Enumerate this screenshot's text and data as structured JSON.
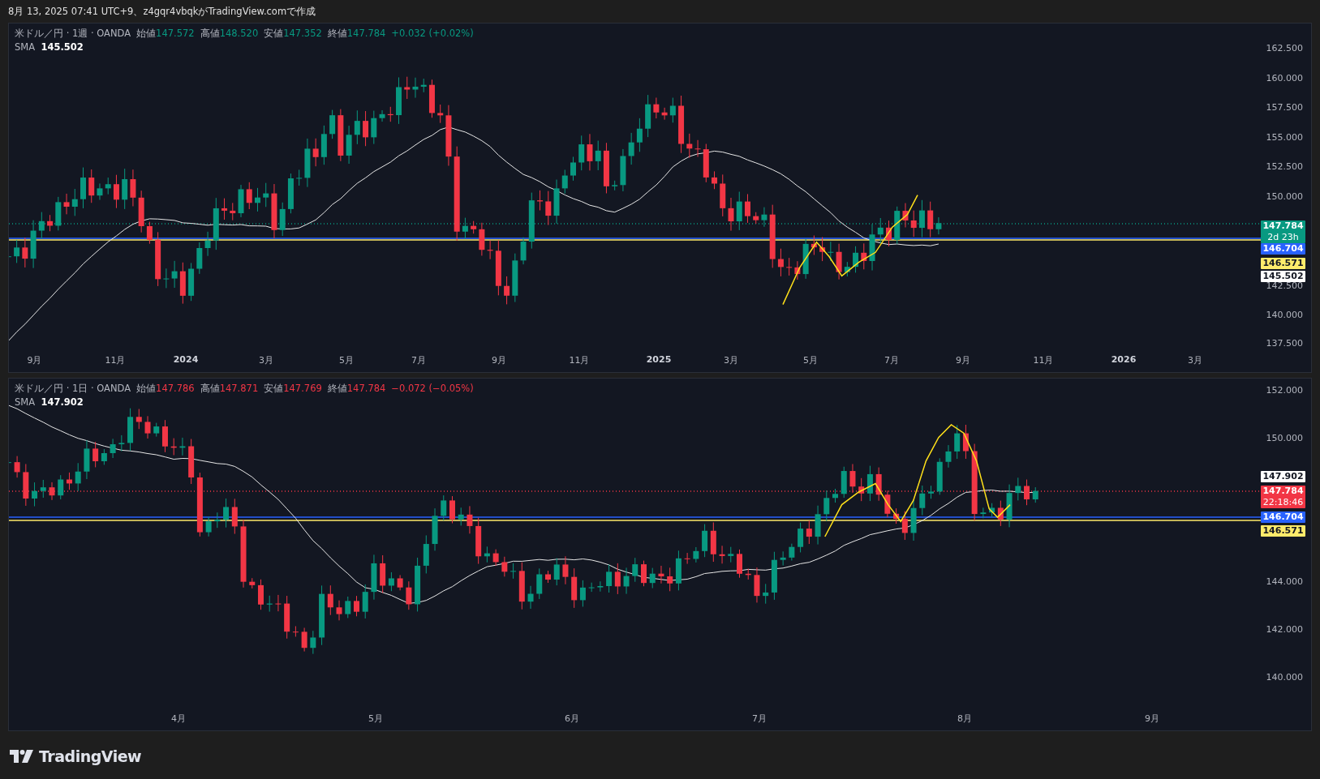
{
  "header": {
    "text": "8月 13, 2025 07:41 UTC+9、z4gqr4vbqkがTradingView.comで作成"
  },
  "panes": [
    {
      "symbol": "米ドル／円 · 1週 · OANDA",
      "rising": true,
      "ohlc": [
        {
          "label": "始値",
          "value": "147.572"
        },
        {
          "label": "高値",
          "value": "148.520"
        },
        {
          "label": "安値",
          "value": "147.352"
        },
        {
          "label": "終値",
          "value": "147.784"
        }
      ],
      "change": "+0.032 (+0.02%)",
      "sma": {
        "label": "SMA",
        "value": "145.502"
      },
      "price_axis": [
        "162.500",
        "160.000",
        "157.500",
        "155.000",
        "152.500",
        "150.000",
        "142.500",
        "140.000",
        "137.500"
      ],
      "price_tags": [
        {
          "text": "147.784",
          "sub": "2d 23h",
          "color": "#089981"
        },
        {
          "text": "146.704",
          "color": "#2962ff"
        },
        {
          "text": "146.571",
          "color": "#ffeb6b"
        },
        {
          "text": "145.502",
          "color": "#ffffff"
        }
      ],
      "time_axis": [
        {
          "label": "9月",
          "kind": "month"
        },
        {
          "label": "11月",
          "kind": "month"
        },
        {
          "label": "2024",
          "kind": "year"
        },
        {
          "label": "3月",
          "kind": "month"
        },
        {
          "label": "5月",
          "kind": "month"
        },
        {
          "label": "7月",
          "kind": "month"
        },
        {
          "label": "9月",
          "kind": "month"
        },
        {
          "label": "11月",
          "kind": "month"
        },
        {
          "label": "2025",
          "kind": "year"
        },
        {
          "label": "3月",
          "kind": "month"
        },
        {
          "label": "5月",
          "kind": "month"
        },
        {
          "label": "7月",
          "kind": "month"
        },
        {
          "label": "9月",
          "kind": "month"
        },
        {
          "label": "11月",
          "kind": "month"
        },
        {
          "label": "2026",
          "kind": "year"
        },
        {
          "label": "3月",
          "kind": "month"
        }
      ]
    },
    {
      "symbol": "米ドル／円 · 1日 · OANDA",
      "rising": false,
      "ohlc": [
        {
          "label": "始値",
          "value": "147.786"
        },
        {
          "label": "高値",
          "value": "147.871"
        },
        {
          "label": "安値",
          "value": "147.769"
        },
        {
          "label": "終値",
          "value": "147.784"
        }
      ],
      "change": "−0.072 (−0.05%)",
      "sma": {
        "label": "SMA",
        "value": "147.902"
      },
      "price_axis": [
        "152.000",
        "150.000",
        "144.000",
        "142.000",
        "140.000"
      ],
      "price_tags": [
        {
          "text": "147.902",
          "color": "#ffffff"
        },
        {
          "text": "147.784",
          "sub": "22:18:46",
          "color": "#f23645"
        },
        {
          "text": "146.704",
          "color": "#2962ff"
        },
        {
          "text": "146.571",
          "color": "#ffeb6b"
        }
      ],
      "time_axis": [
        {
          "label": "4月",
          "kind": "month"
        },
        {
          "label": "5月",
          "kind": "month"
        },
        {
          "label": "6月",
          "kind": "month"
        },
        {
          "label": "7月",
          "kind": "month"
        },
        {
          "label": "8月",
          "kind": "month"
        },
        {
          "label": "9月",
          "kind": "month"
        }
      ]
    }
  ],
  "footer": {
    "logo_text": "TradingView"
  }
}
